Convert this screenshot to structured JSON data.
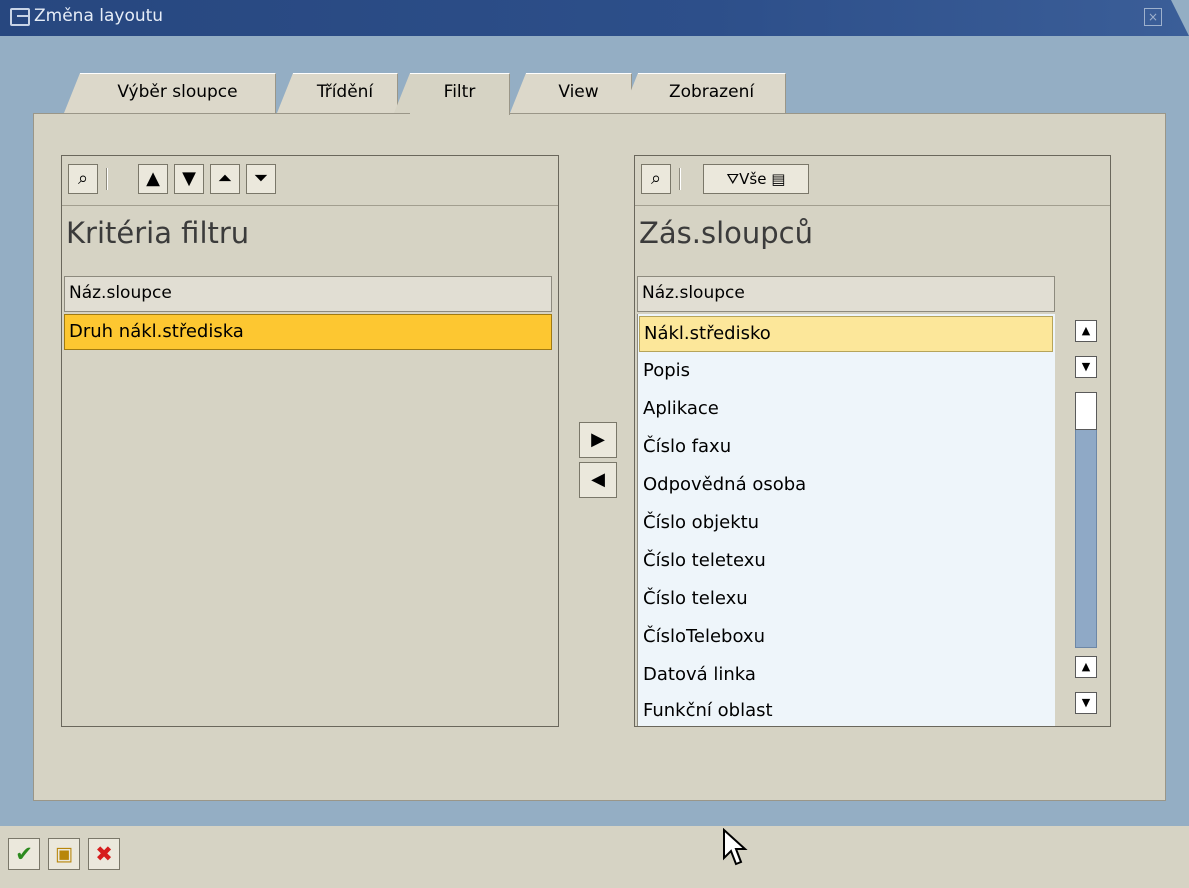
{
  "window": {
    "title": "Změna layoutu"
  },
  "tabs": [
    {
      "label": "Výběr sloupce"
    },
    {
      "label": "Třídění"
    },
    {
      "label": "Filtr",
      "active": true
    },
    {
      "label": "View"
    },
    {
      "label": "Zobrazení"
    }
  ],
  "left": {
    "title": "Kritéria filtru",
    "column_header": "Náz.sloupce",
    "rows": [
      "Druh nákl.střediska"
    ]
  },
  "right": {
    "title": "Zás.sloupců",
    "toolbar_all_label": "Vše",
    "column_header": "Náz.sloupce",
    "rows": [
      "Nákl.středisko",
      "Popis",
      "Aplikace",
      "Číslo faxu",
      "Odpovědná osoba",
      "Číslo objektu",
      "Číslo teletexu",
      "Číslo telexu",
      "ČísloTeleboxu",
      "Datová linka",
      "Funkční oblast"
    ]
  },
  "icons": {
    "find": "binoculars-icon",
    "up": "move-up-icon",
    "down": "move-down-icon",
    "top": "move-top-icon",
    "bottom": "move-bottom-icon",
    "filter": "filter-icon",
    "details": "details-icon",
    "confirm": "checkmark-icon",
    "save": "save-icon",
    "cancel": "cancel-icon"
  },
  "colors": {
    "titlebar": "#2d4f8a",
    "panel": "#d6d3c4",
    "selected_row": "#fdc731",
    "highlight_row": "#fce79a",
    "list_bg": "#eef5fa"
  }
}
